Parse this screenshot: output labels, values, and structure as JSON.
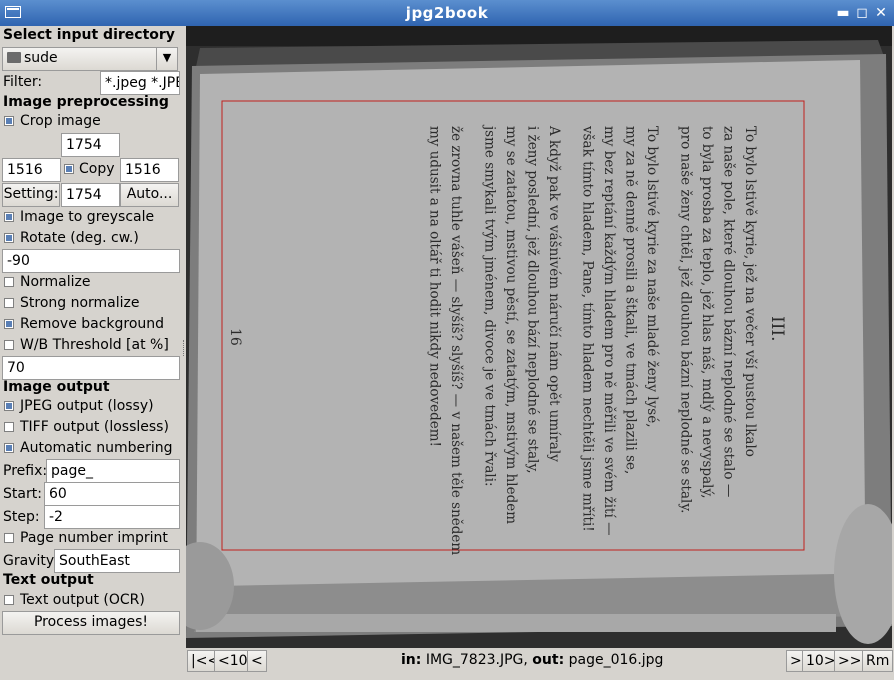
{
  "window": {
    "title": "jpg2book"
  },
  "input": {
    "header": "Select input directory",
    "directory": "sude",
    "filter_label": "Filter:",
    "filter_value": "*.jpeg *.JPEG"
  },
  "preprocessing": {
    "header": "Image preprocessing",
    "crop_label": "Crop image",
    "crop_top": "1754",
    "crop_left": "1516",
    "copy_label": "Copy",
    "crop_right": "1516",
    "setting_label": "Setting:",
    "crop_bottom": "1754",
    "auto_label": "Auto...",
    "greyscale_label": "Image to greyscale",
    "rotate_label": "Rotate (deg. cw.)",
    "rotate_value": "-90",
    "normalize_label": "Normalize",
    "strong_normalize_label": "Strong normalize",
    "remove_bg_label": "Remove background",
    "threshold_label": "W/B Threshold [at %]",
    "threshold_value": "70"
  },
  "output": {
    "header": "Image output",
    "jpeg_label": "JPEG output (lossy)",
    "tiff_label": "TIFF output (lossless)",
    "autonum_label": "Automatic numbering",
    "prefix_label": "Prefix:",
    "prefix_value": "page_",
    "start_label": "Start:",
    "start_value": "60",
    "step_label": "Step:",
    "step_value": "-2",
    "imprint_label": "Page number imprint",
    "gravity_label": "Gravity:",
    "gravity_value": "SouthEast"
  },
  "text_output": {
    "header": "Text output",
    "ocr_label": "Text output (OCR)"
  },
  "process_label": "Process images!",
  "nav": {
    "first": "|<<",
    "back10": "<10",
    "back": "<",
    "status_in_label": "in:",
    "status_in_value": "IMG_7823.JPG,",
    "status_out_label": "out:",
    "status_out_value": "page_016.jpg",
    "forward": ">",
    "forward10": "10>",
    "last": ">>|",
    "remove": "Rm"
  },
  "page": {
    "chapter": "III.",
    "page_number": "16",
    "lines": [
      "To bylo lstivě kyrie, jež na večer vší pustou lkalo",
      "za naše pole, které dlouhou bázní neplodné se stalo —",
      "to byla prosba za teplo, jež hlas náš, mdlý a nevyspalý,",
      "pro naše ženy chtěl, jež dlouhou bázní neplodné se staly.",
      "",
      "To bylo lstivé kyrie za naše mladé ženy lysé,",
      "my za ně denně prosili a štkali, ve tmách plazili se,",
      "my bez reptání každým hladem pro ně měřili ve svém žití —",
      "však tímto hladem, Pane, tímto hladem nechtěli jsme mříti!",
      "",
      "A když pak ve vášnivém náručí nám opět umíraly",
      "i ženy poslední, jež dlouhou bází neplodné se staly,",
      "my se zatatou, mstivou pěstí, se zatatým, mstivým hledem",
      "jsme smykali tvým jménem, divoce je ve tmách řvali:",
      "",
      "že zrovna tuhle vášeň — slyšíš? slyšíš? — v našem těle snědem",
      "my udusit a na oltář ti hodit nikdy nedovedem!"
    ]
  },
  "colors": {
    "titlebar": "#3d74bf",
    "crop_rect": "#c0201e",
    "check_on": "#5a7fb5"
  }
}
